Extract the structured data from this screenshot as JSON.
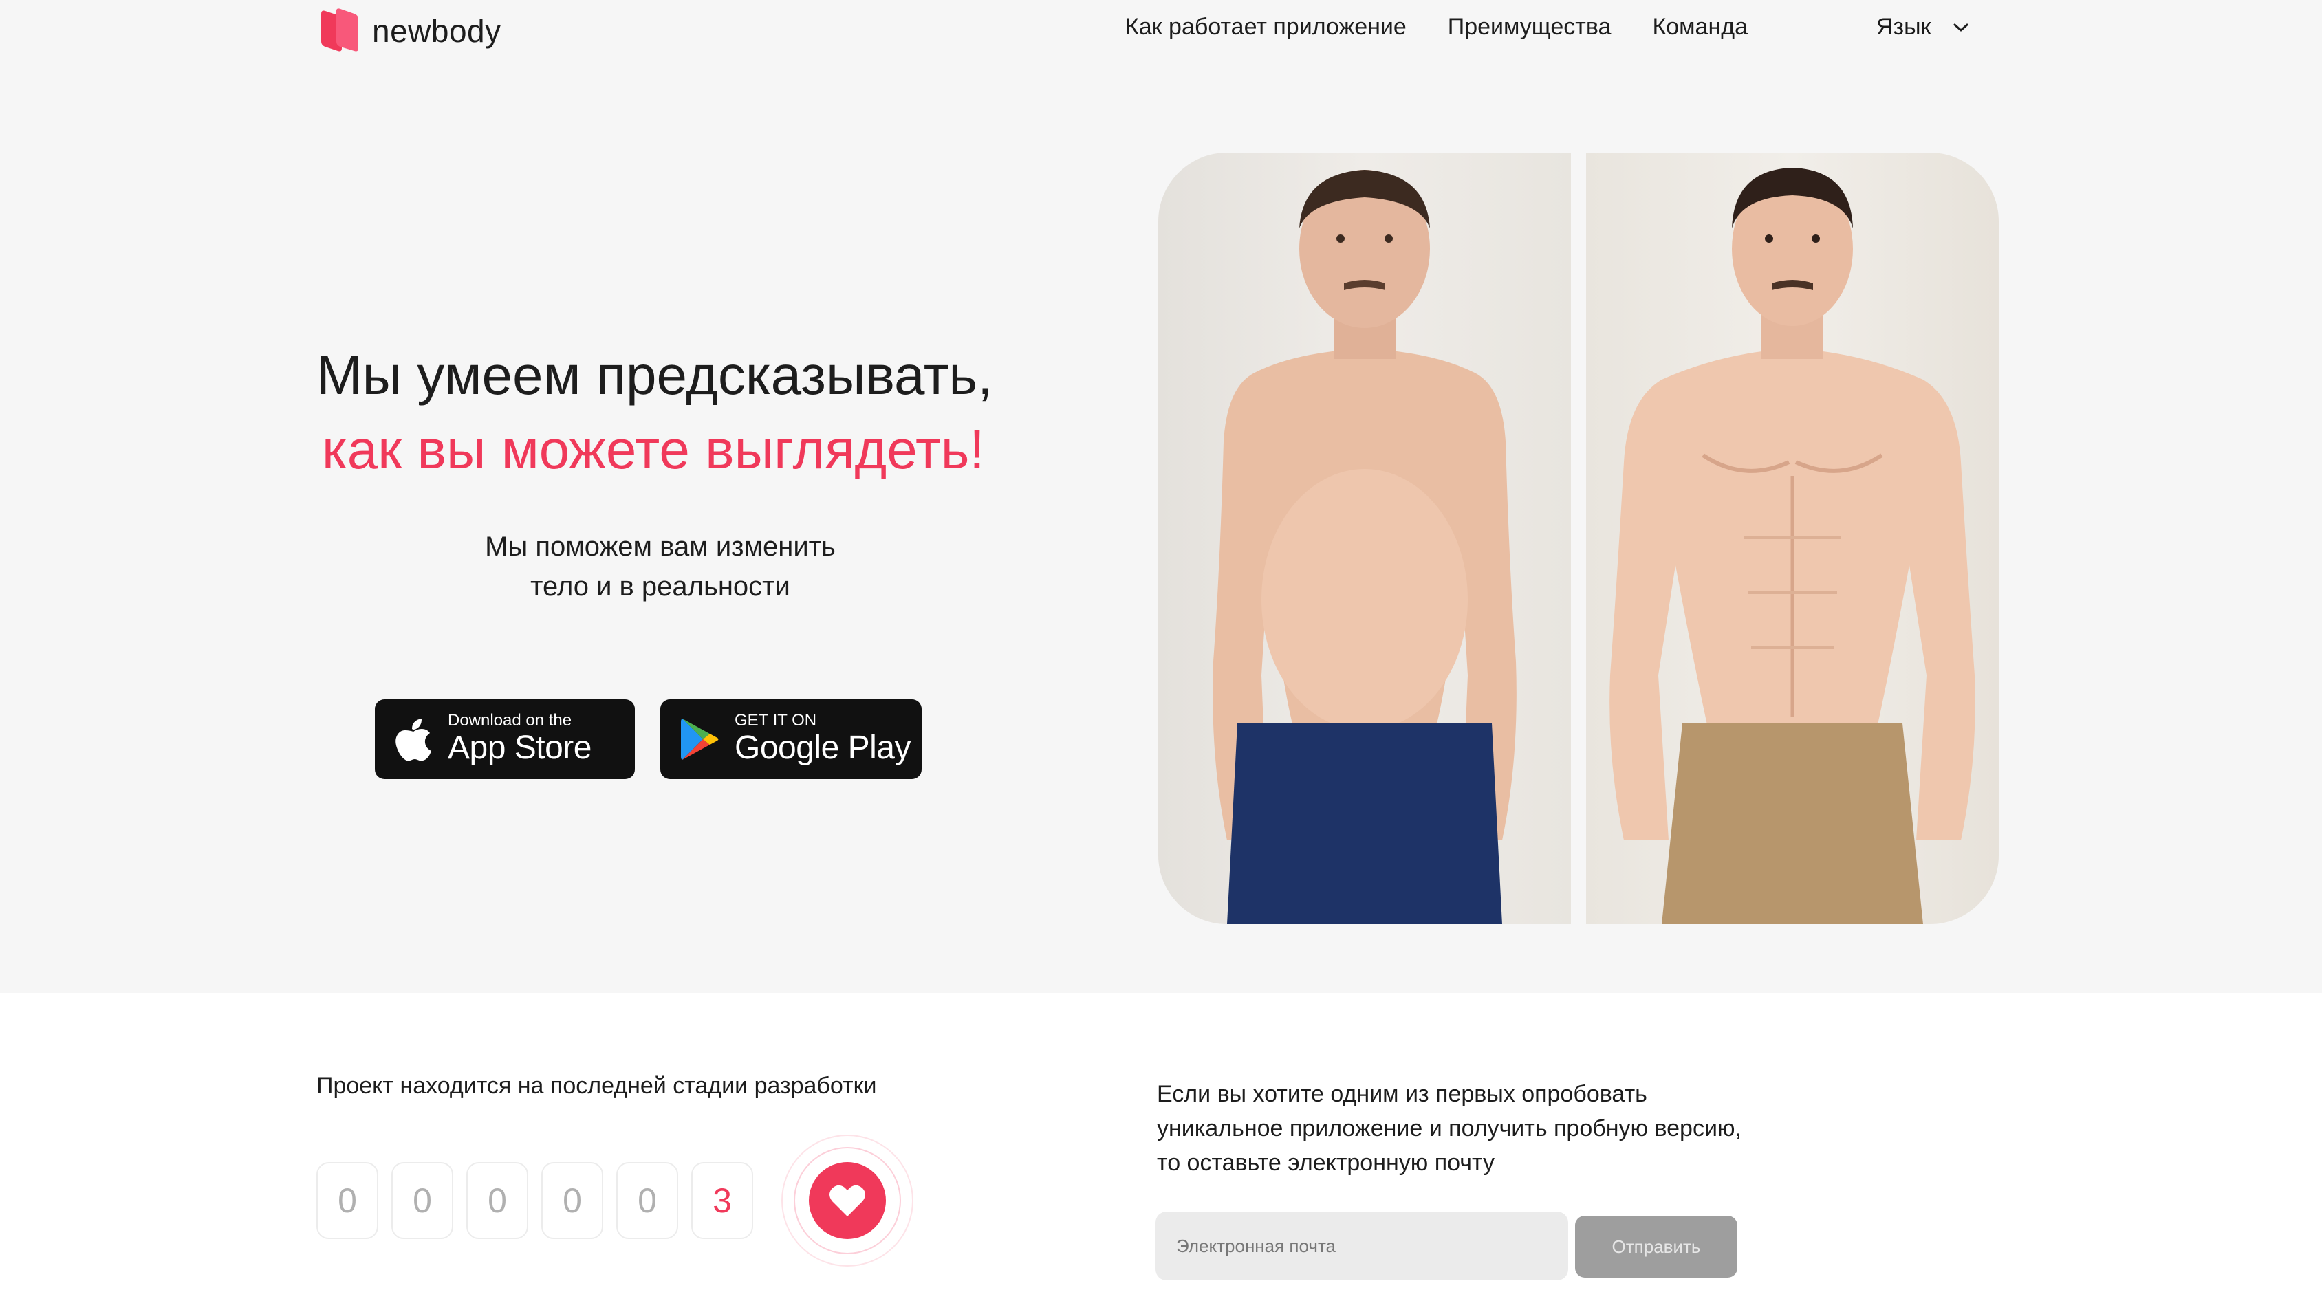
{
  "header": {
    "logo_text": "newbody",
    "nav": [
      "Как работает приложение",
      "Преимущества",
      "Команда"
    ],
    "language_label": "Язык"
  },
  "hero": {
    "headline_line1": "Мы умеем предсказывать,",
    "headline_line2": "как вы можете выглядеть!",
    "subtext_line1": "Мы поможем вам изменить",
    "subtext_line2": "тело и в реальности",
    "accent_color": "#f0395a",
    "app_store": {
      "small": "Download on the",
      "big": "App Store"
    },
    "google_play": {
      "small": "GET IT ON",
      "big": "Google Play"
    }
  },
  "progress": {
    "title": "Проект находится на последней стадии разработки",
    "digits": [
      "0",
      "0",
      "0",
      "0",
      "0",
      "3"
    ]
  },
  "signup": {
    "line1": "Если вы хотите одним из первых опробовать",
    "line2": "уникальное приложение и получить пробную версию,",
    "line3": "то оставьте электронную почту",
    "email_placeholder": "Электронная почта",
    "submit_label": "Отправить"
  }
}
